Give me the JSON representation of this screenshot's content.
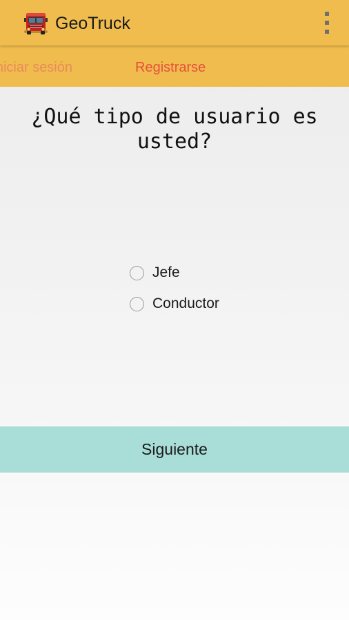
{
  "action_bar": {
    "app_icon": "red-truck-icon",
    "title": "GeoTruck",
    "overflow_icon": "overflow-menu-icon",
    "background_color": "#f0bc4e"
  },
  "tabs": [
    {
      "label": "Iniciar sesión",
      "selected": false,
      "color": "#e98a5c"
    },
    {
      "label": "Registrarse",
      "selected": true,
      "color": "#e5523d"
    }
  ],
  "main": {
    "question": "¿Qué tipo de usuario es usted?",
    "options": [
      {
        "label": "Jefe",
        "checked": false
      },
      {
        "label": "Conductor",
        "checked": false
      }
    ],
    "next_button": {
      "label": "Siguiente",
      "color": "#a9ddd8"
    }
  }
}
